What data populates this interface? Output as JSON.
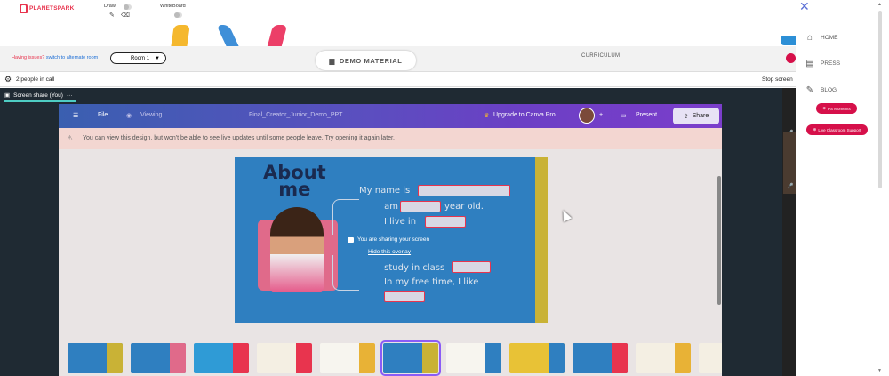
{
  "app": {
    "logo_text": "PLANETSPARK",
    "draw_label": "Draw",
    "whiteboard_label": "WhiteBoard"
  },
  "roombar": {
    "issues_text": "Having issues?",
    "switch_link": "switch to alternate room",
    "room_value": "Room 1",
    "demo_tab": "DEMO MATERIAL",
    "curriculum_tab": "CURRICULUM"
  },
  "peoplebar": {
    "people_count": "2 people in call",
    "stop_label": "Stop screen"
  },
  "screenshare": {
    "header": "Screen share (You)",
    "more": "···"
  },
  "canva": {
    "menu_file": "File",
    "viewing": "Viewing",
    "doc_title": "Final_Creator_Junior_Demo_PPT ...",
    "upgrade": "Upgrade to Canva Pro",
    "plus": "+",
    "present": "Present",
    "share": "Share",
    "warning": "You can view this design, but won't be able to see live updates until some people leave. Try opening it again later."
  },
  "slide": {
    "title_line1": "About",
    "title_line2": "me",
    "lines": [
      "My name is",
      "I am",
      "year old.",
      "I live in",
      "I study in class",
      "In my free time, I like"
    ]
  },
  "overlay": {
    "sharing_text": "You are sharing your screen",
    "hide_link": "Hide this overlay"
  },
  "thumbnails": [
    {
      "bg": "#2f7fc0",
      "accent": "#c9b236"
    },
    {
      "bg": "#2f7fc0",
      "accent": "#e06a8a"
    },
    {
      "bg": "#2f9bd6",
      "accent": "#e8344e"
    },
    {
      "bg": "#f4efe3",
      "accent": "#e8344e"
    },
    {
      "bg": "#f7f5ef",
      "accent": "#e8b236"
    },
    {
      "bg": "#2f7fc0",
      "accent": "#c9b236",
      "selected": true
    },
    {
      "bg": "#f7f5ef",
      "accent": "#2f7fc0"
    },
    {
      "bg": "#e8c236",
      "accent": "#2f7fc0"
    },
    {
      "bg": "#2f7fc0",
      "accent": "#e8344e"
    },
    {
      "bg": "#f4efe3",
      "accent": "#e8b236"
    },
    {
      "bg": "#f4efe3",
      "accent": "#c9b236"
    }
  ],
  "rightnav": {
    "home": "HOME",
    "press": "PRESS",
    "blog": "BLOG",
    "badge1": "PS Moments",
    "badge2": "Live Classroom Support"
  },
  "colors": {
    "brand_red": "#e8344e",
    "badge_crimson": "#d6104a",
    "teal": "#4ecdc4",
    "canva_purple": "#6c3fc5"
  }
}
